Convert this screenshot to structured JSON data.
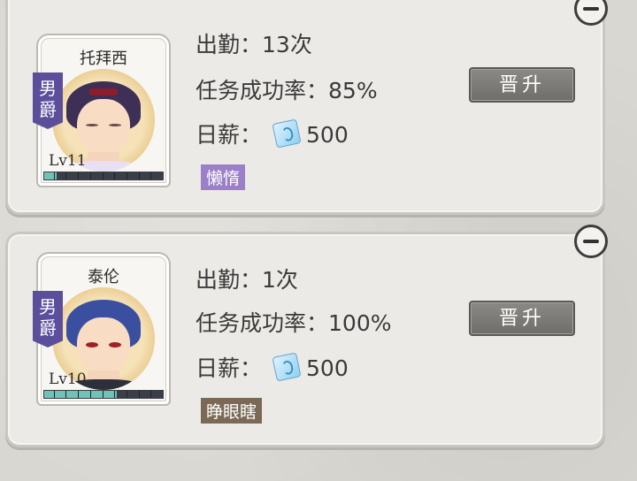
{
  "characters": [
    {
      "name": "托拜西",
      "rank": "男爵",
      "level": "Lv11",
      "xp_fraction": 0.1,
      "attendance_label": "出勤：",
      "attendance_value": "13次",
      "success_label": "任务成功率：",
      "success_value": "85%",
      "salary_label": "日薪：",
      "salary_value": "500",
      "trait": "懒惰",
      "trait_color": "#9b7fc9",
      "promote_label": "晋升"
    },
    {
      "name": "泰伦",
      "rank": "男爵",
      "level": "Lv10",
      "xp_fraction": 0.6,
      "attendance_label": "出勤：",
      "attendance_value": "1次",
      "success_label": "任务成功率：",
      "success_value": "100%",
      "salary_label": "日薪：",
      "salary_value": "500",
      "trait": "睁眼瞎",
      "trait_color": "#7a6a55",
      "promote_label": "晋升"
    }
  ],
  "icons": {
    "remove": "minus-circle-icon",
    "salary": "ticket-icon"
  }
}
